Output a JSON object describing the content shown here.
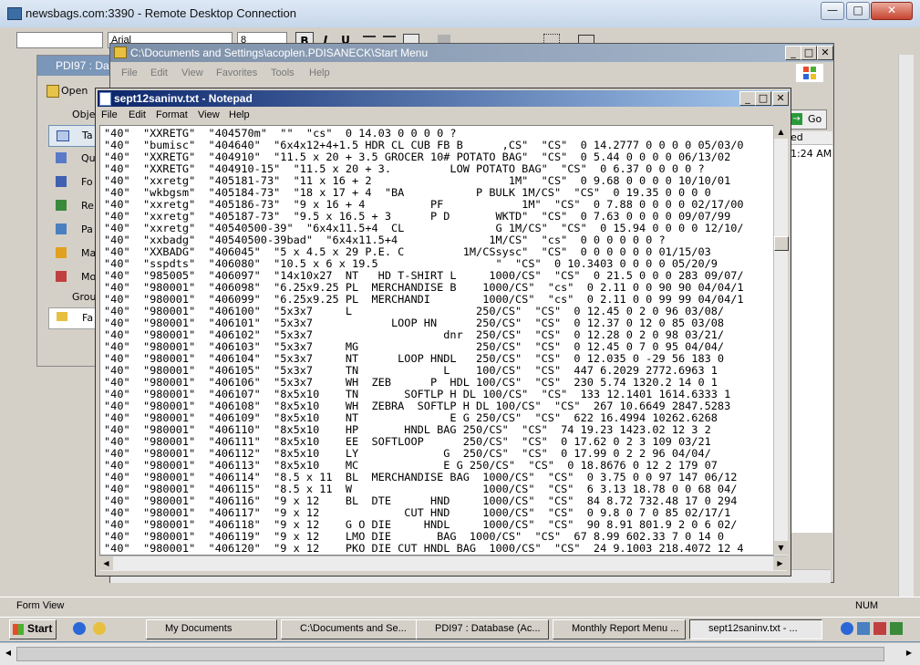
{
  "rdp": {
    "title": "newsbags.com:3390 - Remote Desktop Connection",
    "min": "—",
    "max": "□",
    "close": "✕"
  },
  "formatting": {
    "font_name": "Arial",
    "font_size": "8",
    "bold": "B",
    "italic": "I",
    "underline": "U"
  },
  "dbwin": {
    "title": "PDI97 : Da",
    "open_label": "Open",
    "objects_label": "Obje",
    "groups_label": "Grou",
    "items": [
      "Ta",
      "Qu",
      "Fo",
      "Re",
      "Pa",
      "Ma",
      "Mo",
      "Fa"
    ]
  },
  "explorer": {
    "title": "C:\\Documents and Settings\\acoplen.PDISANECK\\Start Menu",
    "menu": [
      "File",
      "Edit",
      "View",
      "Favorites",
      "Tools",
      "Help"
    ],
    "go_label": "Go",
    "col_label": "ed",
    "time_label": "1:24 AM"
  },
  "notepad": {
    "title": "sept12saninv.txt - Notepad",
    "menu": [
      "File",
      "Edit",
      "Format",
      "View",
      "Help"
    ],
    "lines": [
      "\"40\"  \"XXRETG\"  \"404570m\"  \"\"  \"cs\"  0 14.03 0 0 0 0 ?",
      "\"40\"  \"bumisc\"  \"404640\"  \"6x4x12+4+1.5 HDR CL CUB FB B      ,CS\"  \"CS\"  0 14.2777 0 0 0 0 05/03/0",
      "\"40\"  \"XXRETG\"  \"404910\"  \"11.5 x 20 + 3.5 GROCER 10# POTATO BAG\"  \"CS\"  0 5.44 0 0 0 0 06/13/02",
      "\"40\"  \"XXRETG\"  \"404910-15\"  \"11.5 x 20 + 3.         LOW POTATO BAG\"  \"CS\"  0 6.37 0 0 0 0 ?",
      "\"40\"  \"xxretg\"  \"405181-73\"  \"11 x 16 + 2                     1M\"  \"CS\"  0 9.68 0 0 0 0 10/10/01",
      "\"40\"  \"wkbgsm\"  \"405184-73\"  \"18 x 17 + 4  \"BA           P BULK 1M/CS\"  \"CS\"  0 19.35 0 0 0 0",
      "\"40\"  \"xxretg\"  \"405186-73\"  \"9 x 16 + 4          PF            1M\"  \"CS\"  0 7.88 0 0 0 0 02/17/00",
      "\"40\"  \"xxretg\"  \"405187-73\"  \"9.5 x 16.5 + 3      P D       WKTD\"  \"CS\"  0 7.63 0 0 0 0 09/07/99",
      "\"40\"  \"xxretg\"  \"40540500-39\"  \"6x4x11.5+4  CL              G 1M/CS\"  \"CS\"  0 15.94 0 0 0 0 12/10/",
      "\"40\"  \"xxbadg\"  \"40540500-39bad\"  \"6x4x11.5+4              1M/CS\"  \"cs\"  0 0 0 0 0 0 ?",
      "\"40\"  \"XXBADG\"  \"406045\"  \"5 x 4.5 x 29 P.E. C         1M/CSsysc\"  \"CS\"  0 0 0 0 0 0 01/15/03",
      "\"40\"  \"sspdts\"  \"406080\"  \"10.5 x 6 x 19.5                  \"  \"CS\"  0 10.3403 0 0 0 0 05/20/9",
      "\"40\"  \"985005\"  \"406097\"  \"14x10x27  NT   HD T-SHIRT L     1000/CS\"  \"CS\"  0 21.5 0 0 0 283 09/07/",
      "\"40\"  \"980001\"  \"406098\"  \"6.25x9.25 PL  MERCHANDISE B    1000/CS\"  \"cs\"  0 2.11 0 0 90 90 04/04/1",
      "\"40\"  \"980001\"  \"406099\"  \"6.25x9.25 PL  MERCHANDI        1000/CS\"  \"cs\"  0 2.11 0 0 99 99 04/04/1",
      "\"40\"  \"980001\"  \"406100\"  \"5x3x7     L                   250/CS\"  \"CS\"  0 12.45 0 2 0 96 03/08/",
      "\"40\"  \"980001\"  \"406101\"  \"5x3x7            LOOP HN      250/CS\"  \"CS\"  0 12.37 0 12 0 85 03/08",
      "\"40\"  \"980001\"  \"406102\"  \"5x3x7                    dnr  250/CS\"  \"CS\"  0 12.28 0 2 0 98 03/21/",
      "\"40\"  \"980001\"  \"406103\"  \"5x3x7     MG                  250/CS\"  \"CS\"  0 12.45 0 7 0 95 04/04/",
      "\"40\"  \"980001\"  \"406104\"  \"5x3x7     NT      LOOP HNDL   250/CS\"  \"CS\"  0 12.035 0 -29 56 183 0",
      "\"40\"  \"980001\"  \"406105\"  \"5x3x7     TN             L    100/CS\"  \"CS\"  447 6.2029 2772.6963 1",
      "\"40\"  \"980001\"  \"406106\"  \"5x3x7     WH  ZEB      P  HDL 100/CS\"  \"CS\"  230 5.74 1320.2 14 0 1",
      "\"40\"  \"980001\"  \"406107\"  \"8x5x10    TN       SOFTLP H DL 100/CS\"  \"CS\"  133 12.1401 1614.6333 1",
      "\"40\"  \"980001\"  \"406108\"  \"8x5x10    WH  ZEBRA  SOFTLP H DL 100/CS\"  \"CS\"  267 10.6649 2847.5283",
      "\"40\"  \"980001\"  \"406109\"  \"8x5x10    NT              E G 250/CS\"  \"CS\"  622 16.4994 10262.6268",
      "\"40\"  \"980001\"  \"406110\"  \"8x5x10    HP       HNDL BAG 250/CS\"  \"CS\"  74 19.23 1423.02 12 3 2",
      "\"40\"  \"980001\"  \"406111\"  \"8x5x10    EE  SOFTLOOP      250/CS\"  \"CS\"  0 17.62 0 2 3 109 03/21",
      "\"40\"  \"980001\"  \"406112\"  \"8x5x10    LY             G  250/CS\"  \"CS\"  0 17.99 0 2 2 96 04/04/",
      "\"40\"  \"980001\"  \"406113\"  \"8x5x10    MC             E G 250/CS\"  \"CS\"  0 18.8676 0 12 2 179 07",
      "\"40\"  \"980001\"  \"406114\"  \"8.5 x 11  BL  MERCHANDISE BAG  1000/CS\"  \"CS\"  0 3.75 0 0 97 147 06/12",
      "\"40\"  \"980001\"  \"406115\"  \"8.5 x 11  W                    1000/CS\"  \"CS\"  6 3.13 18.78 0 0 68 04/",
      "\"40\"  \"980001\"  \"406116\"  \"9 x 12    BL  DTE      HND     1000/CS\"  \"CS\"  84 8.72 732.48 17 0 294",
      "\"40\"  \"980001\"  \"406117\"  \"9 x 12             CUT HND     1000/CS\"  \"CS\"  0 9.8 0 7 0 85 02/17/1",
      "\"40\"  \"980001\"  \"406118\"  \"9 x 12    G O DIE     HNDL     1000/CS\"  \"CS\"  90 8.91 801.9 2 0 6 02/",
      "\"40\"  \"980001\"  \"406119\"  \"9 x 12    LMO DIE       BAG  1000/CS\"  \"CS\"  67 8.99 602.33 7 0 14 0",
      "\"40\"  \"980001\"  \"406120\"  \"9 x 12    PKO DIE CUT HNDL BAG  1000/CS\"  \"CS\"  24 9.1003 218.4072 12 4"
    ]
  },
  "status": {
    "form_view": "Form View",
    "num": "NUM"
  },
  "taskbar": {
    "start": "Start",
    "tasks": [
      "My Documents",
      "C:\\Documents and Se...",
      "PDI97 : Database (Ac...",
      "Monthly Report Menu ...",
      "sept12saninv.txt - ..."
    ]
  }
}
